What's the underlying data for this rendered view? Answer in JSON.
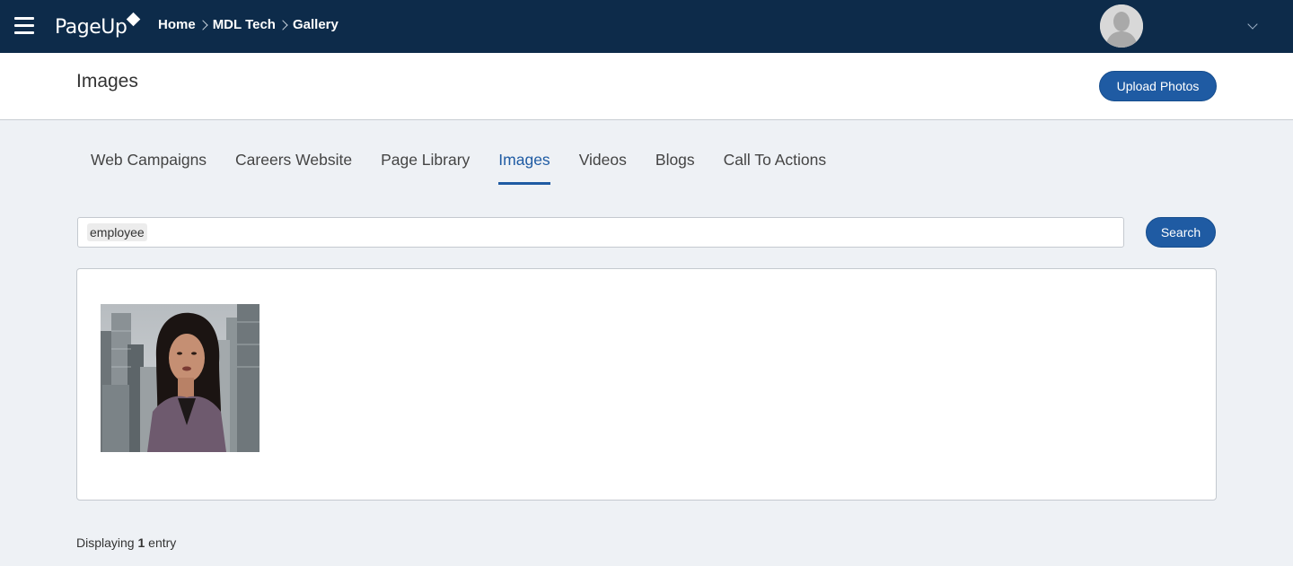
{
  "app": {
    "logo_text": "PageUp",
    "breadcrumb": [
      {
        "label": "Home"
      },
      {
        "label": "MDL Tech"
      },
      {
        "label": "Gallery"
      }
    ]
  },
  "header": {
    "title": "Images",
    "upload_label": "Upload Photos"
  },
  "tabs": [
    {
      "label": "Web Campaigns",
      "active": false
    },
    {
      "label": "Careers Website",
      "active": false
    },
    {
      "label": "Page Library",
      "active": false
    },
    {
      "label": "Images",
      "active": true
    },
    {
      "label": "Videos",
      "active": false
    },
    {
      "label": "Blogs",
      "active": false
    },
    {
      "label": "Call To Actions",
      "active": false
    }
  ],
  "search": {
    "tag": "employee",
    "button_label": "Search"
  },
  "results": {
    "count_prefix": "Displaying",
    "count": "1",
    "count_suffix": "entry"
  },
  "colors": {
    "topbar": "#0d2b4a",
    "accent": "#1f5ba3",
    "background": "#eef1f5"
  }
}
